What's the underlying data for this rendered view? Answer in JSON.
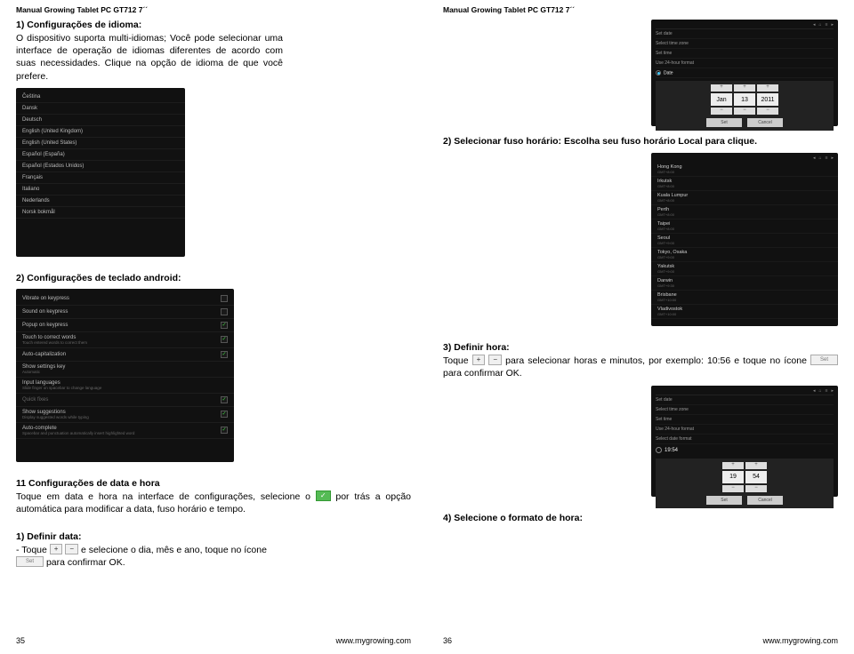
{
  "headerLeft": "Manual Growing Tablet PC GT712 7´´",
  "headerRight": "Manual Growing Tablet PC GT712 7´´",
  "left": {
    "sec1_title": "1) Configurações de idioma:",
    "sec1_body": "O dispositivo suporta multi-idiomas; Você pode selecionar uma interface de operação de idiomas diferentes de acordo com suas necessidades. Clique na opção de idioma de que você prefere.",
    "languages": [
      "Čeština",
      "Dansk",
      "Deutsch",
      "English (United Kingdom)",
      "English (United States)",
      "Español (España)",
      "Español (Estados Unidos)",
      "Français",
      "Italiano",
      "Nederlands",
      "Norsk bokmål"
    ],
    "sec2_title": "2) Configurações de teclado android:",
    "kb": [
      {
        "label": "Vibrate on keypress",
        "chk": false
      },
      {
        "label": "Sound on keypress",
        "chk": false
      },
      {
        "label": "Popup on keypress",
        "chk": true
      },
      {
        "label": "Touch to correct words",
        "sub": "Touch entered words to correct them",
        "chk": true
      },
      {
        "label": "Auto-capitalization",
        "chk": true
      },
      {
        "label": "Show settings key",
        "sub": "Automatic"
      },
      {
        "label": "Input languages",
        "sub": "Slide finger on spacebar to change language"
      },
      {
        "label": "Quick fixes",
        "sub": "",
        "chk": true,
        "faded": true
      },
      {
        "label": "Show suggestions",
        "sub": "Display suggested words while typing",
        "chk": true
      },
      {
        "label": "Auto-complete",
        "sub": "Spacebar and punctuation automatically insert highlighted word",
        "chk": true
      }
    ],
    "sec11_title": "11 Configurações de data e hora",
    "sec11_body_a": "Toque em data e hora na interface de configurações, selecione o ",
    "sec11_body_b": " por trás a opção automática para modificar a data, fuso horário e tempo.",
    "def_data_title": "1) Definir data:",
    "def_data_a": "- Toque ",
    "def_data_b": " e selecione o dia, mês e ano, toque no ícone ",
    "def_data_c": " para confirmar OK.",
    "icon_plus": "+",
    "icon_minus": "−",
    "icon_check": "✓",
    "icon_set": "Set"
  },
  "right": {
    "datepick": {
      "rows": [
        "Set date",
        "Select time zone",
        "Set time",
        "Use 24-hour format"
      ],
      "row_hl": "Date",
      "cells": [
        "Jan",
        "13",
        "2011"
      ],
      "btn_set": "Set",
      "btn_cancel": "Cancel"
    },
    "sec2r": "2) Selecionar fuso horário: Escolha seu fuso horário Local para clique.",
    "tz": [
      {
        "c": "Hong Kong",
        "s": "GMT+8:00"
      },
      {
        "c": "Irkutsk",
        "s": "GMT+8:00"
      },
      {
        "c": "Kuala Lumpur",
        "s": "GMT+8:00"
      },
      {
        "c": "Perth",
        "s": "GMT+8:00"
      },
      {
        "c": "Taipei",
        "s": "GMT+8:00"
      },
      {
        "c": "Seoul",
        "s": "GMT+9:00"
      },
      {
        "c": "Tokyo, Osaka",
        "s": "GMT+9:00"
      },
      {
        "c": "Yakutsk",
        "s": "GMT+9:00"
      },
      {
        "c": "Darwin",
        "s": "GMT+9:30"
      },
      {
        "c": "Brisbane",
        "s": "GMT+10:00"
      },
      {
        "c": "Vladivostok",
        "s": "GMT+10:00"
      }
    ],
    "sec3_title": "3) Definir hora:",
    "sec3_a": "Toque ",
    "sec3_b": " para selecionar horas e minutos, por exemplo: 10:56 e toque no ícone ",
    "sec3_c": " para confirmar OK.",
    "timepick": {
      "rows": [
        "Set date",
        "Select time zone",
        "Set time",
        "Use 24-hour format",
        "Select date format"
      ],
      "clock": "19:54",
      "cells": [
        "19",
        "54"
      ],
      "btn_set": "Set",
      "btn_cancel": "Cancel"
    },
    "sec4_title": "4) Selecione o formato de hora:"
  },
  "footer": {
    "leftPage": "35",
    "rightPage": "36",
    "url": "www.mygrowing.com"
  }
}
